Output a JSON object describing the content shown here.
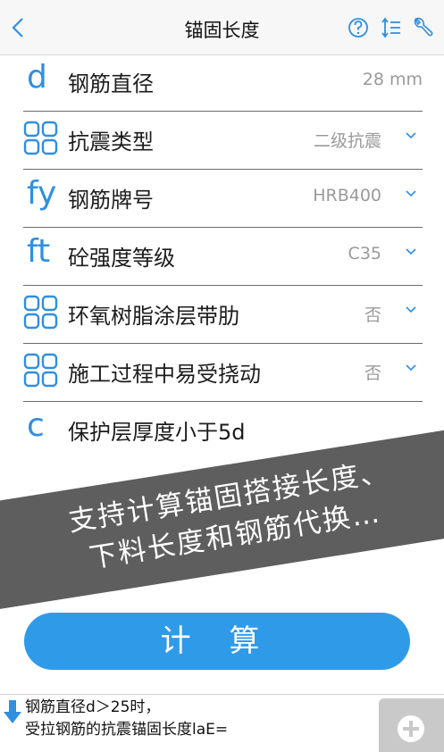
{
  "header": {
    "title": "锚固长度",
    "back_icon": "chevron-left-icon",
    "help_icon": "question-circle-icon",
    "sort_icon": "sort-list-icon",
    "tools_icon": "wrench-icon"
  },
  "colors": {
    "accent": "#2f8fe0",
    "button": "#2f9ae8",
    "banner": "#484848",
    "value_text": "#9a9a9a"
  },
  "rows": [
    {
      "badge": "d",
      "label": "钢筋直径",
      "value": "28 mm"
    },
    {
      "badge": "",
      "label": "抗震类型",
      "value": "二级抗震"
    },
    {
      "badge": "fy",
      "label": "钢筋牌号",
      "value": "HRB400"
    },
    {
      "badge": "ft",
      "label": "砼强度等级",
      "value": "C35"
    },
    {
      "badge": "",
      "label": "环氧树脂涂层带肋",
      "value": "否"
    },
    {
      "badge": "",
      "label": "施工过程中易受挠动",
      "value": "否"
    },
    {
      "badge": "c",
      "label": "保护层厚度小于5d",
      "value": ""
    }
  ],
  "banner": {
    "line1": "支持计算锚固搭接长度、",
    "line2": "下料长度和钢筋代换…"
  },
  "calc_button": "计 算",
  "result": {
    "line1": "钢筋直径d＞25时，",
    "line2": "受拉钢筋的抗震锚固长度laE="
  }
}
